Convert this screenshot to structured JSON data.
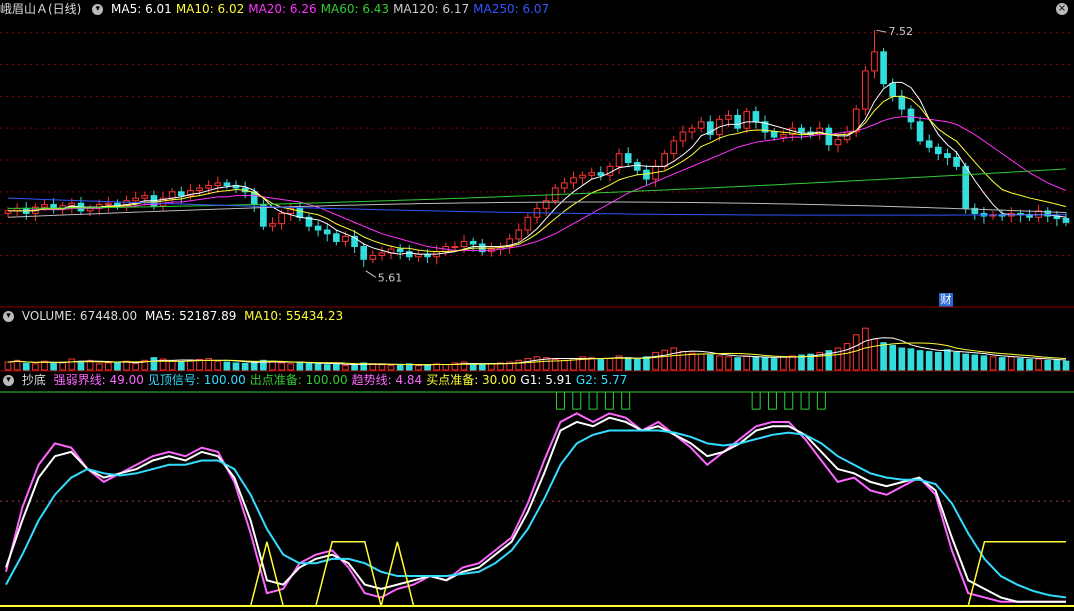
{
  "price_panel": {
    "title": "峨眉山Ａ(日线)",
    "mas": [
      {
        "label": "MA5: 6.01",
        "color": "#ffffff"
      },
      {
        "label": "MA10: 6.02",
        "color": "#ffff33"
      },
      {
        "label": "MA20: 6.26",
        "color": "#ff33ff"
      },
      {
        "label": "MA60: 6.43",
        "color": "#33cc33"
      },
      {
        "label": "MA120: 6.17",
        "color": "#cccccc"
      },
      {
        "label": "MA250: 6.07",
        "color": "#3355ff"
      }
    ],
    "high_label": "7.52",
    "low_label": "5.61",
    "fin_badge": "财"
  },
  "volume_panel": {
    "title": "VOLUME: 67448.00",
    "ma5": "MA5: 52187.89",
    "ma10": "MA10: 55434.23"
  },
  "indicator_panel": {
    "title": "抄底",
    "items": [
      {
        "label": "强弱界线: 49.00",
        "color": "#ff66ff"
      },
      {
        "label": "见顶信号: 100.00",
        "color": "#33ddff"
      },
      {
        "label": "出点准备: 100.00",
        "color": "#33cc33"
      },
      {
        "label": "趋势线: 4.84",
        "color": "#ff66ff"
      },
      {
        "label": "买点准备: 30.00",
        "color": "#ffff33"
      },
      {
        "label": "G1: 5.91",
        "color": "#ffffff"
      },
      {
        "label": "G2: 5.77",
        "color": "#33ddff"
      }
    ]
  },
  "colors": {
    "up": "#ff3333",
    "down": "#33dddd",
    "grid": "#8b0000"
  },
  "chart_data": {
    "type": "candlestick",
    "price_range": [
      5.4,
      7.6
    ],
    "price_ticks": [
      5.75,
      6.0,
      6.25,
      6.5,
      6.75,
      7.0,
      7.25,
      7.5
    ],
    "close": [
      6.1,
      6.12,
      6.08,
      6.13,
      6.15,
      6.12,
      6.14,
      6.16,
      6.1,
      6.12,
      6.15,
      6.16,
      6.14,
      6.18,
      6.2,
      6.22,
      6.14,
      6.2,
      6.25,
      6.22,
      6.26,
      6.28,
      6.3,
      6.32,
      6.3,
      6.28,
      6.25,
      6.15,
      5.98,
      6.0,
      6.08,
      6.12,
      6.05,
      5.98,
      5.95,
      5.92,
      5.86,
      5.9,
      5.82,
      5.72,
      5.75,
      5.77,
      5.8,
      5.78,
      5.74,
      5.76,
      5.74,
      5.78,
      5.82,
      5.82,
      5.86,
      5.84,
      5.78,
      5.8,
      5.82,
      5.88,
      5.95,
      6.05,
      6.12,
      6.18,
      6.28,
      6.32,
      6.36,
      6.38,
      6.4,
      6.38,
      6.45,
      6.55,
      6.48,
      6.42,
      6.35,
      6.45,
      6.55,
      6.65,
      6.72,
      6.75,
      6.8,
      6.7,
      6.82,
      6.85,
      6.75,
      6.88,
      6.8,
      6.72,
      6.68,
      6.7,
      6.75,
      6.72,
      6.7,
      6.75,
      6.62,
      6.66,
      6.72,
      6.9,
      7.2,
      7.35,
      7.1,
      7.0,
      6.9,
      6.8,
      6.65,
      6.6,
      6.55,
      6.52,
      6.45,
      6.12,
      6.08,
      6.06,
      6.07,
      6.06,
      6.08,
      6.07,
      6.05,
      6.1,
      6.06,
      6.04,
      6.01
    ],
    "ma5": [
      6.1,
      6.1,
      6.1,
      6.1,
      6.12,
      6.12,
      6.12,
      6.14,
      6.13,
      6.13,
      6.13,
      6.14,
      6.14,
      6.15,
      6.16,
      6.18,
      6.18,
      6.19,
      6.2,
      6.21,
      6.23,
      6.24,
      6.26,
      6.28,
      6.29,
      6.3,
      6.29,
      6.26,
      6.2,
      6.13,
      6.09,
      6.07,
      6.05,
      6.04,
      6.03,
      6.0,
      5.95,
      5.92,
      5.89,
      5.84,
      5.81,
      5.79,
      5.77,
      5.76,
      5.77,
      5.76,
      5.76,
      5.76,
      5.77,
      5.78,
      5.8,
      5.82,
      5.82,
      5.82,
      5.82,
      5.83,
      5.85,
      5.9,
      5.96,
      6.04,
      6.12,
      6.19,
      6.25,
      6.3,
      6.35,
      6.37,
      6.4,
      6.44,
      6.45,
      6.46,
      6.45,
      6.45,
      6.45,
      6.49,
      6.54,
      6.6,
      6.69,
      6.72,
      6.76,
      6.78,
      6.78,
      6.8,
      6.8,
      6.79,
      6.77,
      6.75,
      6.73,
      6.71,
      6.71,
      6.72,
      6.7,
      6.69,
      6.69,
      6.73,
      6.82,
      6.96,
      7.06,
      7.11,
      7.11,
      7.07,
      6.97,
      6.82,
      6.7,
      6.62,
      6.56,
      6.45,
      6.34,
      6.24,
      6.15,
      6.08,
      6.07,
      6.07,
      6.07,
      6.07,
      6.07,
      6.06,
      6.05
    ],
    "ma20": [
      6.1,
      6.1,
      6.1,
      6.11,
      6.11,
      6.11,
      6.11,
      6.12,
      6.12,
      6.12,
      6.12,
      6.13,
      6.13,
      6.13,
      6.14,
      6.15,
      6.15,
      6.16,
      6.17,
      6.17,
      6.18,
      6.19,
      6.2,
      6.21,
      6.21,
      6.22,
      6.22,
      6.22,
      6.21,
      6.2,
      6.19,
      6.18,
      6.17,
      6.15,
      6.13,
      6.1,
      6.07,
      6.04,
      6.01,
      5.98,
      5.95,
      5.92,
      5.9,
      5.88,
      5.86,
      5.84,
      5.82,
      5.81,
      5.8,
      5.79,
      5.79,
      5.79,
      5.79,
      5.79,
      5.8,
      5.81,
      5.82,
      5.84,
      5.86,
      5.89,
      5.92,
      5.96,
      6.0,
      6.04,
      6.08,
      6.12,
      6.16,
      6.2,
      6.24,
      6.27,
      6.3,
      6.33,
      6.36,
      6.39,
      6.42,
      6.45,
      6.48,
      6.51,
      6.54,
      6.57,
      6.6,
      6.62,
      6.64,
      6.65,
      6.66,
      6.67,
      6.68,
      6.68,
      6.69,
      6.7,
      6.7,
      6.71,
      6.72,
      6.73,
      6.75,
      6.78,
      6.81,
      6.83,
      6.84,
      6.84,
      6.83,
      6.82,
      6.81,
      6.8,
      6.78,
      6.74,
      6.7,
      6.65,
      6.6,
      6.55,
      6.5,
      6.45,
      6.4,
      6.36,
      6.32,
      6.29,
      6.26
    ],
    "ma60_start": 6.12,
    "ma60_end": 6.43,
    "ma250_start": 6.2,
    "ma250_end": 6.07,
    "volume": [
      18,
      22,
      15,
      14,
      20,
      16,
      18,
      25,
      20,
      22,
      14,
      16,
      18,
      20,
      15,
      22,
      28,
      25,
      20,
      18,
      22,
      24,
      26,
      20,
      18,
      16,
      15,
      18,
      22,
      20,
      16,
      14,
      18,
      16,
      14,
      12,
      14,
      10,
      12,
      16,
      14,
      12,
      10,
      12,
      14,
      10,
      12,
      14,
      12,
      16,
      18,
      14,
      12,
      14,
      16,
      18,
      22,
      26,
      30,
      28,
      24,
      22,
      26,
      30,
      28,
      24,
      26,
      32,
      28,
      24,
      30,
      40,
      45,
      50,
      42,
      38,
      36,
      34,
      32,
      30,
      28,
      32,
      30,
      28,
      26,
      30,
      32,
      34,
      36,
      40,
      44,
      50,
      60,
      80,
      95,
      70,
      62,
      56,
      50,
      48,
      44,
      42,
      40,
      46,
      40,
      36,
      34,
      32,
      30,
      28,
      30,
      26,
      24,
      25,
      22,
      22,
      20
    ],
    "vol_range": [
      0,
      100
    ],
    "indicator_range": [
      0,
      100
    ],
    "g1": [
      18,
      40,
      60,
      70,
      72,
      64,
      60,
      62,
      64,
      68,
      70,
      68,
      72,
      70,
      60,
      40,
      12,
      10,
      18,
      22,
      24,
      20,
      10,
      8,
      10,
      12,
      14,
      12,
      16,
      18,
      24,
      30,
      44,
      62,
      82,
      86,
      84,
      88,
      86,
      82,
      84,
      80,
      76,
      70,
      72,
      76,
      82,
      84,
      84,
      80,
      72,
      64,
      62,
      58,
      56,
      58,
      60,
      54,
      32,
      12,
      8,
      4,
      2,
      2,
      2,
      2
    ],
    "g2": [
      10,
      24,
      40,
      52,
      60,
      64,
      62,
      61,
      62,
      64,
      66,
      66,
      68,
      68,
      64,
      52,
      36,
      24,
      20,
      20,
      22,
      22,
      20,
      16,
      14,
      14,
      14,
      14,
      15,
      16,
      20,
      26,
      36,
      50,
      66,
      76,
      80,
      82,
      82,
      82,
      82,
      81,
      79,
      76,
      75,
      76,
      78,
      80,
      81,
      80,
      76,
      70,
      66,
      62,
      60,
      59,
      59,
      57,
      48,
      34,
      22,
      14,
      10,
      7,
      5,
      4
    ],
    "trend": [
      16,
      46,
      66,
      76,
      74,
      64,
      58,
      62,
      66,
      70,
      72,
      70,
      74,
      72,
      58,
      34,
      6,
      8,
      20,
      24,
      26,
      18,
      6,
      4,
      8,
      10,
      14,
      12,
      18,
      20,
      26,
      32,
      48,
      68,
      86,
      90,
      86,
      90,
      88,
      82,
      86,
      80,
      74,
      66,
      72,
      78,
      84,
      86,
      86,
      78,
      68,
      58,
      60,
      54,
      52,
      56,
      60,
      52,
      26,
      6,
      4,
      2,
      2,
      2,
      2,
      2
    ],
    "buy_level": [
      0,
      0,
      0,
      0,
      0,
      0,
      0,
      0,
      0,
      0,
      0,
      0,
      0,
      0,
      0,
      0,
      30,
      0,
      0,
      0,
      30,
      30,
      30,
      0,
      30,
      0,
      0,
      0,
      0,
      0,
      0,
      0,
      0,
      0,
      0,
      0,
      0,
      0,
      0,
      0,
      0,
      0,
      0,
      0,
      0,
      0,
      0,
      0,
      0,
      0,
      0,
      0,
      0,
      0,
      0,
      0,
      0,
      0,
      0,
      0,
      30,
      30,
      30,
      30,
      30,
      30
    ]
  }
}
